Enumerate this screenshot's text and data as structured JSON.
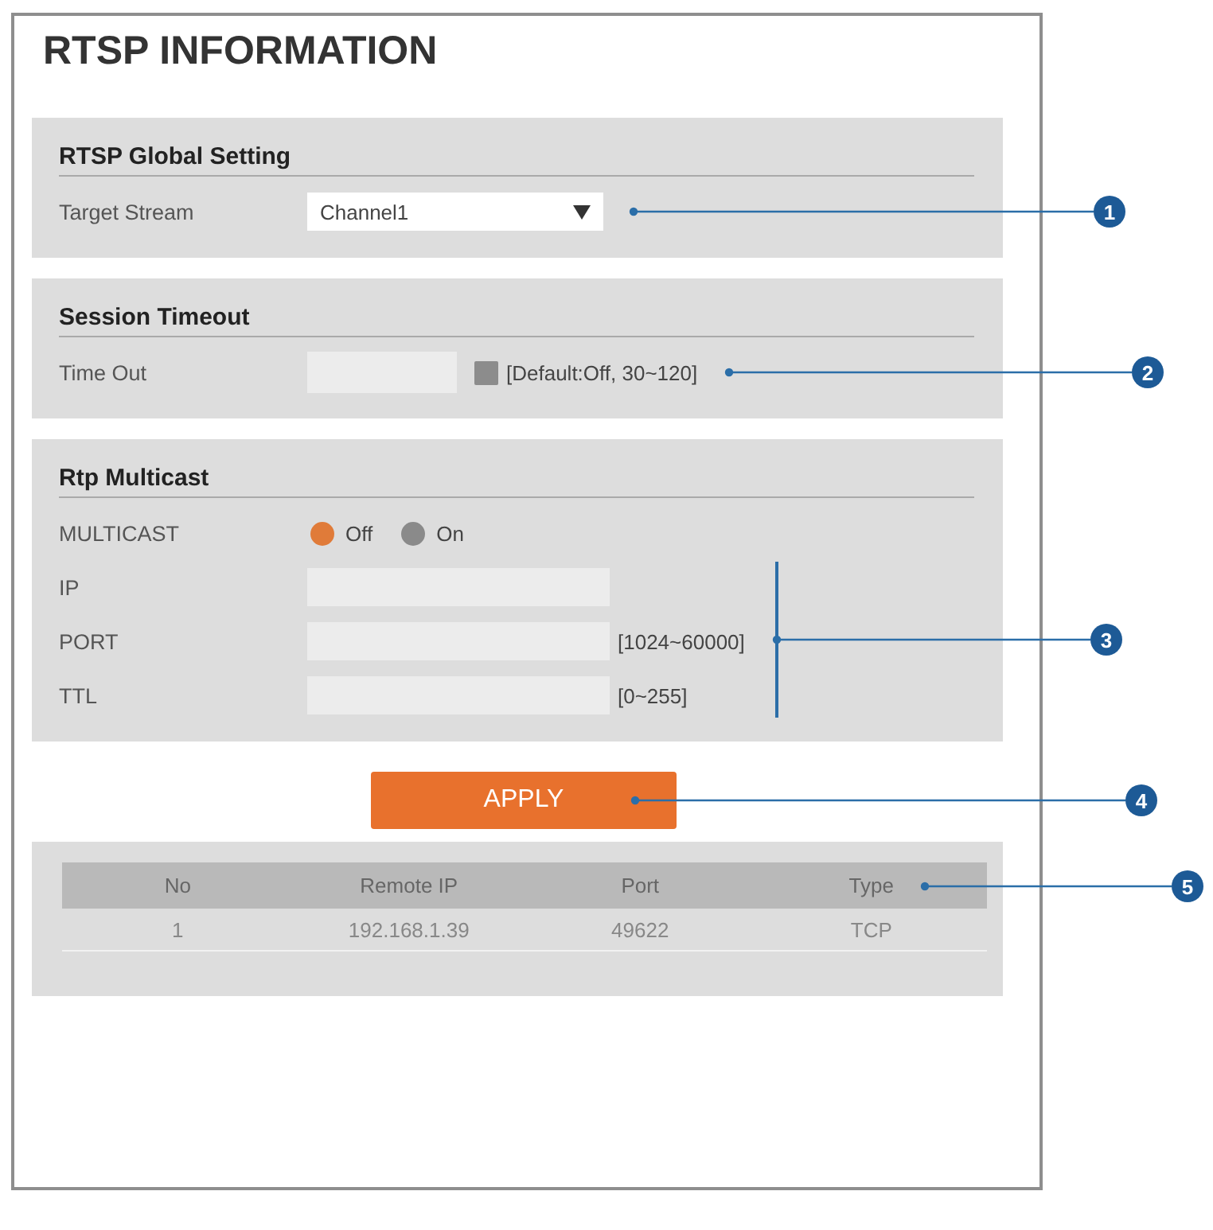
{
  "title": "RTSP INFORMATION",
  "sections": [
    {
      "heading": "RTSP Global Setting",
      "rows": [
        {
          "kind": "select",
          "label": "Target Stream",
          "value": "Channel1",
          "callout": "1"
        }
      ]
    },
    {
      "heading": "Session Timeout",
      "rows": [
        {
          "kind": "toggle_input",
          "label": "Time Out",
          "disabled": true,
          "checked": false,
          "hint": "[Default:Off, 30~120]",
          "callout": "2"
        }
      ]
    },
    {
      "heading": "Rtp Multicast",
      "callout": "3",
      "rows": [
        {
          "kind": "radio",
          "label": "MULTICAST",
          "options": [
            {
              "label": "Off",
              "selected": true
            },
            {
              "label": "On",
              "selected": false
            }
          ]
        },
        {
          "kind": "input",
          "label": "IP",
          "disabled": true
        },
        {
          "kind": "input",
          "label": "PORT",
          "disabled": true,
          "hint": "[1024~60000]"
        },
        {
          "kind": "input",
          "label": "TTL",
          "disabled": true,
          "hint": "[0~255]"
        }
      ]
    }
  ],
  "apply_button": {
    "label": "APPLY",
    "callout": "4"
  },
  "sessions_table": {
    "callout": "5",
    "columns": [
      "No",
      "Remote IP",
      "Port",
      "Type"
    ],
    "rows": [
      [
        "1",
        "192.168.1.39",
        "49622",
        "TCP"
      ]
    ]
  }
}
